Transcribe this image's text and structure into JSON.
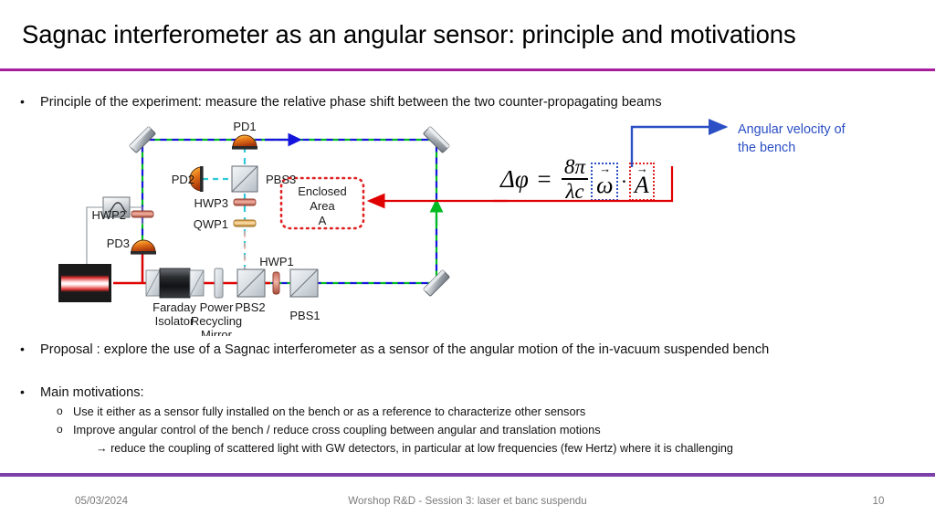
{
  "slide": {
    "title": "Sagnac interferometer as an angular sensor: principle and motivations",
    "accent_top": "#A81C9E",
    "accent_bottom": "#7D3FA8"
  },
  "bullets": {
    "mark": "•",
    "sub_mark": "o",
    "principle": "Principle of the experiment: measure the relative phase shift between the two counter-propagating beams",
    "proposal": "Proposal : explore the use of a Sagnac interferometer as a sensor of the angular motion of the in-vacuum suspended bench",
    "motivations": "Main motivations:",
    "sub_use_sensor": "Use it either as a sensor fully installed on the bench or as a reference to characterize other sensors",
    "sub_improve": "Improve angular control of the bench / reduce cross coupling between angular and translation motions",
    "arrow_reduce": "→ reduce the coupling of scattered light with GW detectors, in particular at low frequencies (few Hertz) where it is challenging"
  },
  "equation": {
    "lhs": "Δφ",
    "equals": "=",
    "numerator": "8π",
    "denominator": "λc",
    "vec_omega": "ω",
    "vec_area": "A",
    "vec_hat": "→",
    "dot": "·",
    "omega_box_color": "#2B4FC4",
    "area_box_color": "#E02020"
  },
  "callout": {
    "angular_velocity_line1": "Angular velocity of",
    "angular_velocity_line2": "the bench",
    "color": "#2B4FC4"
  },
  "diagram": {
    "labels": {
      "pd1": "PD1",
      "pd2": "PD2",
      "pd3": "PD3",
      "pbs1": "PBS1",
      "pbs2": "PBS2",
      "pbs3": "PBS3",
      "hwp1": "HWP1",
      "hwp2": "HWP2",
      "hwp3": "HWP3",
      "qwp1": "QWP1",
      "faraday_line1": "Faraday",
      "faraday_line2": "Isolator",
      "prm_line1": "Power",
      "prm_line2": "Recycling",
      "prm_line3": "Mirror",
      "enclosed_line1": "Enclosed",
      "enclosed_line2": "Area",
      "enclosed_line3": "A"
    },
    "colors": {
      "laser_beam": "#E00000",
      "beam_green": "#00BB22",
      "beam_blue": "#1414DC",
      "beam_cyan": "#2FC8D8",
      "enclosed_box": "#E02020",
      "mirror_body": "#B8BCC0"
    }
  },
  "footer": {
    "date": "05/03/2024",
    "center": "Worshop R&D - Session 3: laser et banc suspendu",
    "page": "10"
  }
}
